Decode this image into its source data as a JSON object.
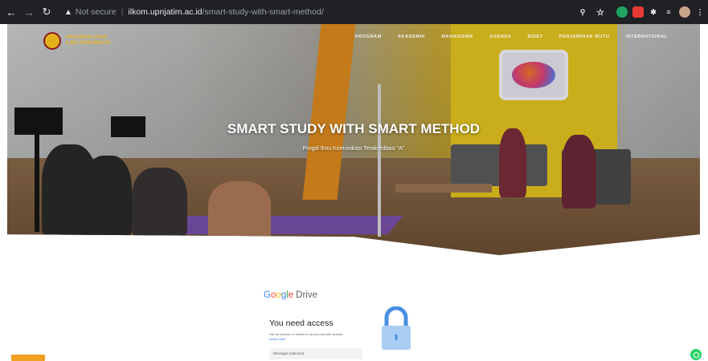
{
  "browser": {
    "security_label": "Not secure",
    "url_host": "ilkom.upnjatim.ac.id",
    "url_path": "/smart-study-with-smart-method/"
  },
  "site": {
    "logo_line1": "Program Studi",
    "logo_line2": "Ilmu Komunikasi",
    "menu": [
      "PROGRAM",
      "AKADEMIK",
      "MAHASISWA",
      "AGENDA",
      "RISET",
      "PENJAMINAN MUTU",
      "INTERNATIONAL"
    ],
    "hero_title": "SMART STUDY WITH SMART METHOD",
    "hero_subtitle": "Progdi Ilmu Komunikasi Terakreditasi \"A\""
  },
  "drive": {
    "brand_letters": [
      "G",
      "o",
      "o",
      "g",
      "l",
      "e"
    ],
    "brand_product": "Drive",
    "heading": "You need access",
    "subtext": "Ask for access, or switch to an account with access.",
    "learn_more": "Learn more",
    "message_placeholder": "Message (optional)"
  },
  "colors": {
    "chrome_bg": "#202124",
    "accent_yellow": "#e5c51f",
    "lock_blue": "#4a90e2",
    "whatsapp": "#25d366"
  }
}
